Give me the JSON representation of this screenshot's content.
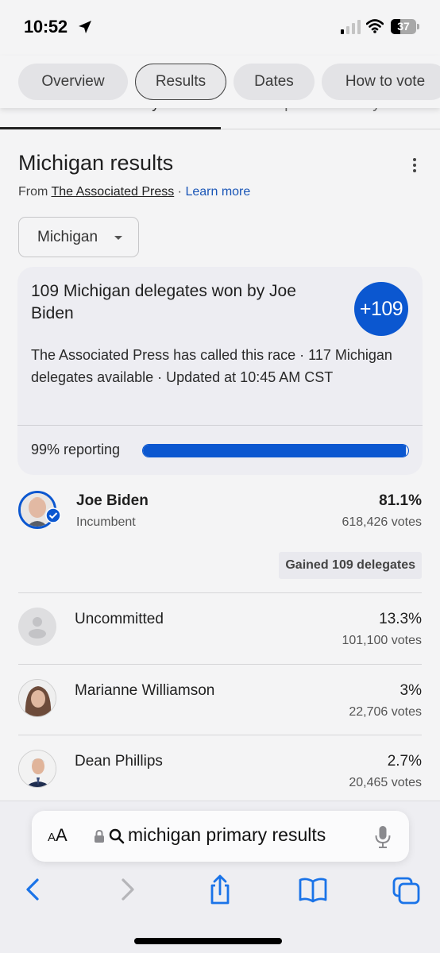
{
  "status_bar": {
    "time": "10:52",
    "battery_percent": 37,
    "battery_label": "37"
  },
  "chips": [
    {
      "label": "Overview",
      "active": false
    },
    {
      "label": "Results",
      "active": true
    },
    {
      "label": "Dates",
      "active": false
    },
    {
      "label": "How to vote",
      "active": false
    }
  ],
  "party_tabs": [
    {
      "label": "Democratic Party",
      "selected": true
    },
    {
      "label": "Republican Party",
      "selected": false
    }
  ],
  "header": {
    "title": "Michigan results",
    "source_prefix": "From ",
    "source_name": "The Associated Press",
    "separator": " · ",
    "learn_more": "Learn more"
  },
  "state_dropdown": {
    "selected": "Michigan"
  },
  "summary": {
    "headline": "109 Michigan delegates won by Joe Biden",
    "badge": "+109",
    "description": "The Associated Press has called this race · 117 Michigan delegates available · Updated at 10:45 AM CST",
    "reporting_label": "99% reporting",
    "reporting_percent": 99
  },
  "candidates": [
    {
      "name": "Joe Biden",
      "subtitle": "Incumbent",
      "percent": "81.1%",
      "votes": "618,426 votes",
      "winner": true,
      "delegates_badge": "Gained 109 delegates"
    },
    {
      "name": "Uncommitted",
      "subtitle": "",
      "percent": "13.3%",
      "votes": "101,100 votes",
      "winner": false
    },
    {
      "name": "Marianne Williamson",
      "subtitle": "",
      "percent": "3%",
      "votes": "22,706 votes",
      "winner": false
    },
    {
      "name": "Dean Phillips",
      "subtitle": "",
      "percent": "2.7%",
      "votes": "20,465 votes",
      "winner": false
    }
  ],
  "browser": {
    "aa_label": "AA",
    "url_text": "michigan primary results"
  },
  "colors": {
    "accent": "#0b57d0",
    "link": "#1a56b7",
    "ios_blue": "#1a73e8"
  }
}
